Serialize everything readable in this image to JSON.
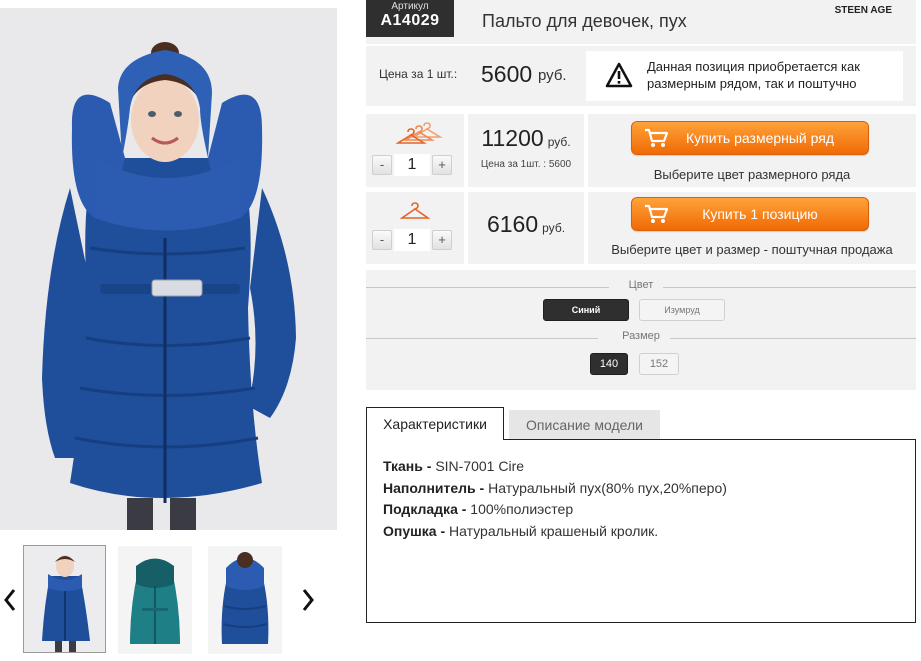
{
  "product": {
    "sku_label": "Артикул",
    "sku": "A14029",
    "title": "Пальто для девочек, пух",
    "brand": "STEEN AGE"
  },
  "unit_price": {
    "label": "Цена за 1 шт.:",
    "value": "5600",
    "currency": "руб."
  },
  "notice": {
    "icon": "warning-icon",
    "text": "Данная позиция приобретается как размерным рядом, так и поштучно"
  },
  "size_pack": {
    "icon": "hangers-icon",
    "quantity": "1",
    "minus": "-",
    "plus": "+",
    "price": "11200",
    "currency": "руб.",
    "unit_note": "Цена за 1шт. : 5600",
    "button_label": "Купить размерный ряд",
    "hint": "Выберите цвет размерного ряда"
  },
  "single": {
    "icon": "hanger-icon",
    "quantity": "1",
    "minus": "-",
    "plus": "+",
    "price": "6160",
    "currency": "руб.",
    "button_label": "Купить 1 позицию",
    "hint": "Выберите цвет и размер - поштучная продажа"
  },
  "options": {
    "color_heading": "Цвет",
    "colors": [
      {
        "label": "Синий",
        "selected": true
      },
      {
        "label": "Изумруд",
        "selected": false
      }
    ],
    "size_heading": "Размер",
    "sizes": [
      {
        "label": "140",
        "selected": true
      },
      {
        "label": "152",
        "selected": false
      }
    ]
  },
  "tabs": [
    {
      "label": "Характеристики",
      "active": true
    },
    {
      "label": "Описание модели",
      "active": false
    }
  ],
  "specs": [
    {
      "key": "Ткань -",
      "value": " SIN-7001 Cire"
    },
    {
      "key": "Наполнитель -",
      "value": " Натуральный пух(80% пух,20%перо)"
    },
    {
      "key": "Подкладка -",
      "value": " 100%полиэстер"
    },
    {
      "key": "Опушка -",
      "value": " Натуральный крашеный кролик."
    }
  ],
  "gallery": {
    "prev_icon": "chevron-left-icon",
    "next_icon": "chevron-right-icon",
    "thumbnails": [
      "coat-blue",
      "coat-emerald",
      "coat-blue-back"
    ]
  },
  "colors": {
    "accent_orange": "#f27a0f",
    "dark": "#2f2f2f",
    "panel_gray": "#f2f2f2",
    "coat_blue": "#1e4f9c",
    "coat_emerald": "#1e7f86"
  }
}
